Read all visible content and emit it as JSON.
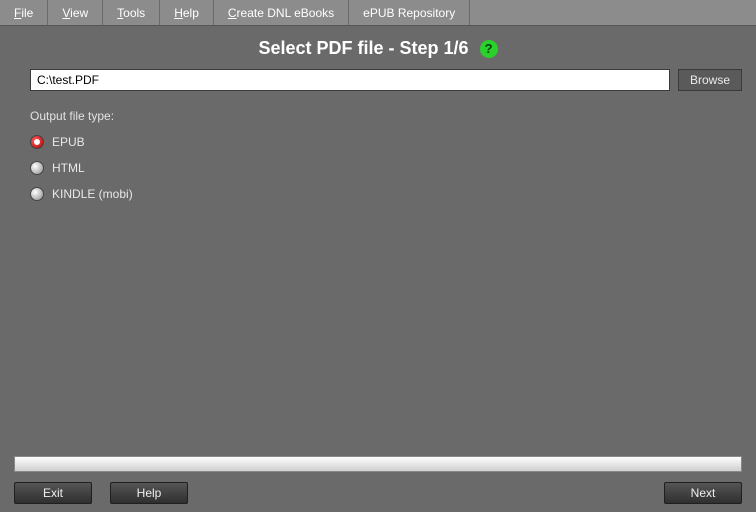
{
  "menu": {
    "file": "File",
    "view": "View",
    "tools": "Tools",
    "help": "Help",
    "create_dnl": "Create DNL eBooks",
    "epub_repo": "ePUB Repository"
  },
  "title": "Select PDF file - Step 1/6",
  "help_icon_glyph": "?",
  "file_path": "C:\\test.PDF",
  "browse_label": "Browse",
  "output_section_label": "Output file type:",
  "output_options": {
    "epub": "EPUB",
    "html": "HTML",
    "kindle": "KINDLE (mobi)"
  },
  "selected_output": "epub",
  "footer": {
    "exit": "Exit",
    "help": "Help",
    "next": "Next"
  }
}
